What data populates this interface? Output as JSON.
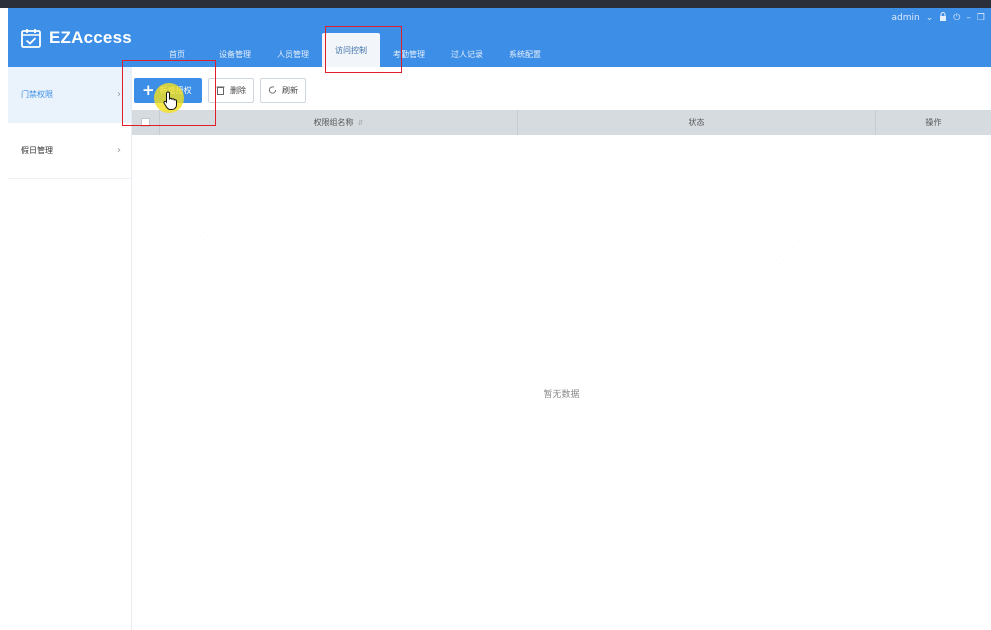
{
  "app": {
    "logo_text": "EZAccess",
    "user": "admin"
  },
  "nav": {
    "tabs": [
      {
        "label": "首页"
      },
      {
        "label": "设备管理"
      },
      {
        "label": "人员管理"
      },
      {
        "label": "访问控制"
      },
      {
        "label": "考勤管理"
      },
      {
        "label": "过人记录"
      },
      {
        "label": "系统配置"
      }
    ],
    "active": "访问控制"
  },
  "sidebar": {
    "items": [
      {
        "label": "门禁权限"
      },
      {
        "label": "假日管理"
      }
    ]
  },
  "toolbar": {
    "add_label": "新增授权",
    "delete_label": "删除",
    "refresh_label": "刷新"
  },
  "table": {
    "columns": {
      "name": "权限组名称",
      "status": "状态",
      "action": "操作"
    },
    "empty_text": "暂无数据"
  },
  "colors": {
    "header_bg": "#3d8ee6",
    "annotation": "#e01f2a",
    "highlight": "#f5e11e"
  }
}
